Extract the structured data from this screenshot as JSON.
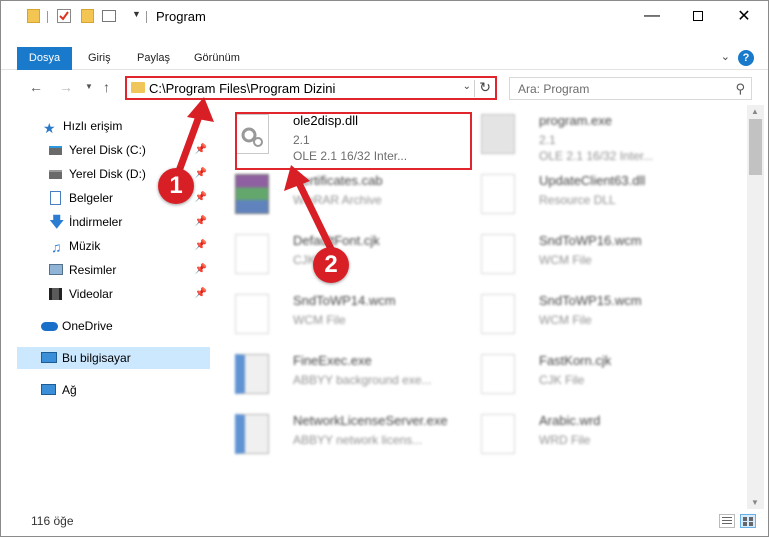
{
  "window": {
    "title": "Program"
  },
  "ribbon": {
    "tabs": [
      "Dosya",
      "Giriş",
      "Paylaş",
      "Görünüm"
    ],
    "help": "?"
  },
  "address": {
    "path": "C:\\Program Files\\Program Dizini"
  },
  "search": {
    "placeholder": "Ara: Program"
  },
  "sidebar": {
    "items": [
      {
        "label": "Hızlı erişim",
        "icon": "star-icon"
      },
      {
        "label": "Yerel Disk (C:)",
        "icon": "drive-icon"
      },
      {
        "label": "Yerel Disk (D:)",
        "icon": "drive-icon"
      },
      {
        "label": "Belgeler",
        "icon": "documents-icon"
      },
      {
        "label": "İndirmeler",
        "icon": "download-icon"
      },
      {
        "label": "Müzik",
        "icon": "music-icon"
      },
      {
        "label": "Resimler",
        "icon": "pictures-icon"
      },
      {
        "label": "Videolar",
        "icon": "videos-icon"
      },
      {
        "label": "OneDrive",
        "icon": "cloud-icon"
      },
      {
        "label": "Bu bilgisayar",
        "icon": "computer-icon"
      },
      {
        "label": "Ağ",
        "icon": "network-icon"
      }
    ]
  },
  "files": [
    {
      "name": "ole2disp.dll",
      "line1": "2.1",
      "line2": "OLE 2.1 16/32 Inter..."
    },
    {
      "name": "program.exe",
      "line1": "2.1",
      "line2": "OLE 2.1 16/32 Inter..."
    },
    {
      "name": "Certificates.cab",
      "line1": "WinRAR Archive",
      "line2": ""
    },
    {
      "name": "UpdateClient63.dll",
      "line1": "Resource DLL",
      "line2": ""
    },
    {
      "name": "DefaultFont.cjk",
      "line1": "CJK File",
      "line2": ""
    },
    {
      "name": "SndToWP16.wcm",
      "line1": "WCM File",
      "line2": ""
    },
    {
      "name": "SndToWP14.wcm",
      "line1": "WCM File",
      "line2": ""
    },
    {
      "name": "SndToWP15.wcm",
      "line1": "WCM File",
      "line2": ""
    },
    {
      "name": "FineExec.exe",
      "line1": "ABBYY background exe...",
      "line2": ""
    },
    {
      "name": "FastKorn.cjk",
      "line1": "CJK File",
      "line2": ""
    },
    {
      "name": "NetworkLicenseServer.exe",
      "line1": "ABBYY network licens...",
      "line2": ""
    },
    {
      "name": "Arabic.wrd",
      "line1": "WRD File",
      "line2": ""
    }
  ],
  "callouts": [
    "1",
    "2"
  ],
  "status": {
    "count": "116 öğe"
  },
  "colors": {
    "accent": "#1979ca",
    "highlight": "#e0262c",
    "callout": "#d81f26",
    "selection": "#cce8ff"
  }
}
